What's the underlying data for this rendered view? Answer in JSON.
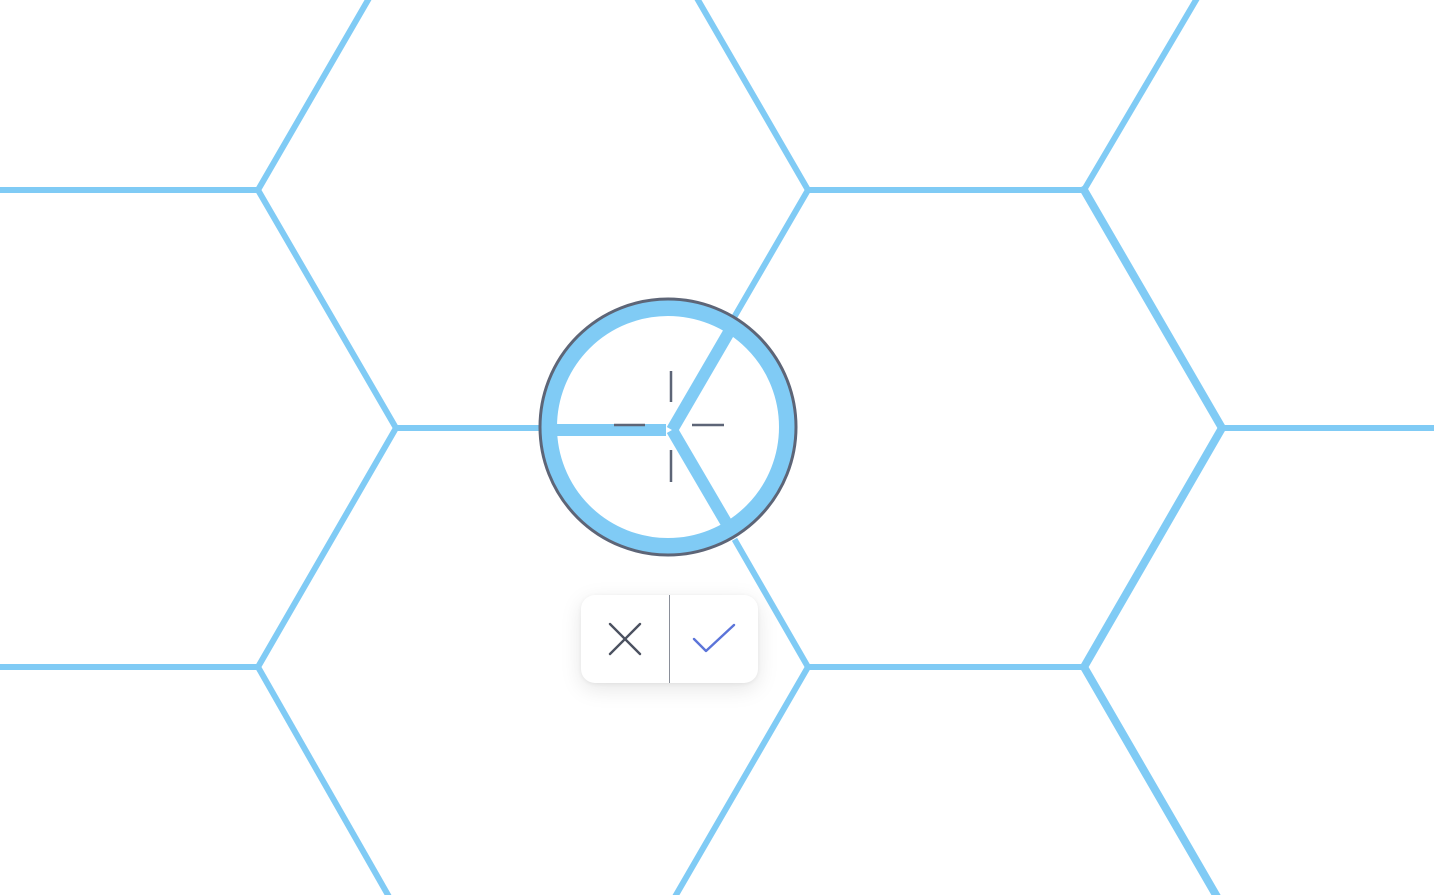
{
  "canvas": {
    "grid_line_color": "#80cbf5",
    "background_color": "#ffffff"
  },
  "magnifier": {
    "ring_color": "#80cbf5",
    "border_color": "#5d6577",
    "crosshair_color": "#5d6577",
    "icon": "crosshair-icon"
  },
  "toolbar": {
    "cancel_icon": "close-icon",
    "cancel_color": "#4b5160",
    "confirm_icon": "checkmark-icon",
    "confirm_color": "#5b74d9"
  }
}
